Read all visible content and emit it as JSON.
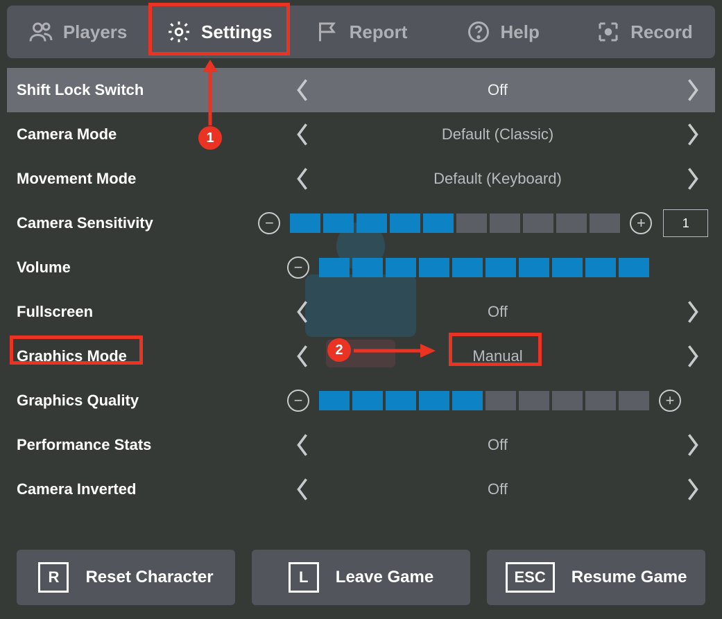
{
  "tabs": {
    "players": "Players",
    "settings": "Settings",
    "report": "Report",
    "help": "Help",
    "record": "Record"
  },
  "settings": {
    "shift_lock": {
      "label": "Shift Lock Switch",
      "value": "Off"
    },
    "camera_mode": {
      "label": "Camera Mode",
      "value": "Default (Classic)"
    },
    "movement_mode": {
      "label": "Movement Mode",
      "value": "Default (Keyboard)"
    },
    "camera_sens": {
      "label": "Camera Sensitivity",
      "filled": 5,
      "total": 10,
      "number": "1"
    },
    "volume": {
      "label": "Volume",
      "filled": 10,
      "total": 10
    },
    "fullscreen": {
      "label": "Fullscreen",
      "value": "Off"
    },
    "graphics_mode": {
      "label": "Graphics Mode",
      "value": "Manual"
    },
    "graphics_quality": {
      "label": "Graphics Quality",
      "filled": 5,
      "total": 10
    },
    "perf_stats": {
      "label": "Performance Stats",
      "value": "Off"
    },
    "camera_inverted": {
      "label": "Camera Inverted",
      "value": "Off"
    }
  },
  "buttons": {
    "reset": {
      "key": "R",
      "label": "Reset Character"
    },
    "leave": {
      "key": "L",
      "label": "Leave Game"
    },
    "resume": {
      "key": "ESC",
      "label": "Resume Game"
    }
  },
  "annotations": {
    "step1": "1",
    "step2": "2"
  }
}
